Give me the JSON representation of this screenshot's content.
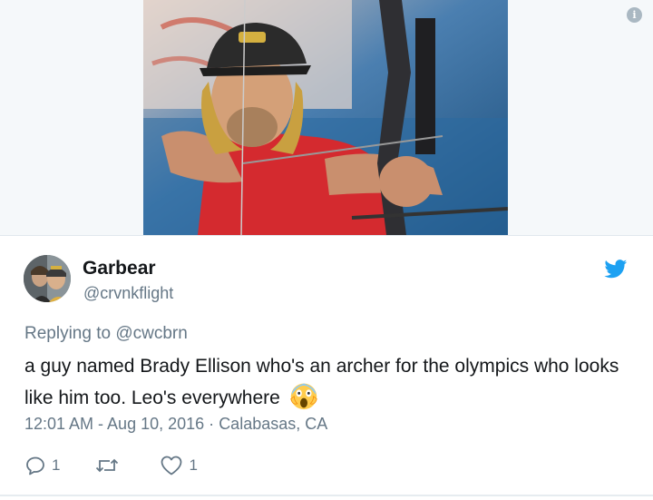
{
  "tweet": {
    "user": {
      "name": "Garbear",
      "handle": "@crvnkflight"
    },
    "reply": {
      "prefix": "Replying to ",
      "mention": "@cwcbrn"
    },
    "text": "a guy named Brady Ellison who's an archer for the olympics who looks like him too. Leo's everywhere",
    "emoji": "face-screaming-in-fear",
    "timestamp": "12:01 AM - Aug 10, 2016",
    "separator": "·",
    "location": "Calabasas, CA",
    "actions": {
      "reply_count": "1",
      "retweet_count": "",
      "like_count": "1"
    }
  },
  "media": {
    "subject": "photo-of-archer-drawing-bow",
    "info_glyph": "i"
  },
  "colors": {
    "text_primary": "#14171a",
    "text_secondary": "#657786",
    "twitter_blue": "#1da1f2",
    "border": "#e1e8ed",
    "media_background": "#f5f8fa"
  }
}
